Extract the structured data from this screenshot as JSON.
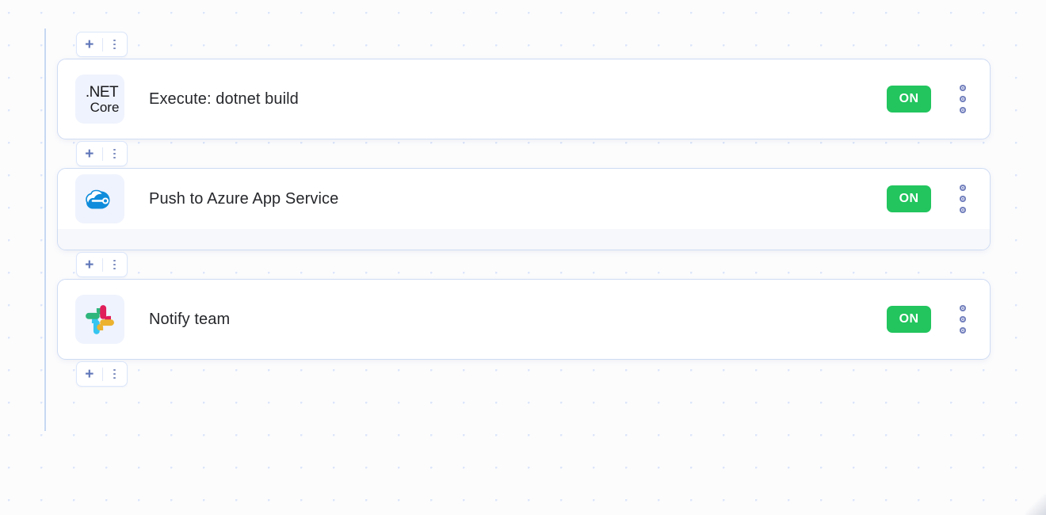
{
  "canvas": {
    "background_color": "#fcfcfd",
    "grid_dot_color": "#dce6fa",
    "connector_color": "#c7d8f2"
  },
  "add_buttons": [
    {
      "id": "add-top",
      "plus_label": "+",
      "menu_icon": "kebab-vertical-icon"
    },
    {
      "id": "add-after-build",
      "plus_label": "+",
      "menu_icon": "kebab-vertical-icon"
    },
    {
      "id": "add-after-azure",
      "plus_label": "+",
      "menu_icon": "kebab-vertical-icon"
    },
    {
      "id": "add-bottom",
      "plus_label": "+",
      "menu_icon": "kebab-vertical-icon"
    }
  ],
  "nodes": [
    {
      "id": "node-dotnet-build",
      "icon": "dotnet-core-icon",
      "icon_text_line1": ".NET",
      "icon_text_line2": "Core",
      "title": "Execute: dotnet build",
      "status": "ON",
      "status_color": "#22c55e",
      "menu_icon": "kebab-vertical-icon",
      "has_footer": false
    },
    {
      "id": "node-azure-app-service",
      "icon": "azure-cloud-icon",
      "title": "Push to Azure App Service",
      "status": "ON",
      "status_color": "#22c55e",
      "menu_icon": "kebab-vertical-icon",
      "has_footer": true
    },
    {
      "id": "node-notify-team",
      "icon": "slack-icon",
      "title": "Notify team",
      "status": "ON",
      "status_color": "#22c55e",
      "menu_icon": "kebab-vertical-icon",
      "has_footer": false
    }
  ]
}
